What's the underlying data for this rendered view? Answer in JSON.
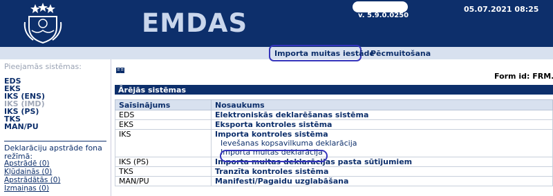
{
  "header": {
    "brand": "EMDAS",
    "version": "v. 5.9.0.0250",
    "datetime": "05.07.2021 08:25"
  },
  "nav": {
    "items": [
      {
        "label": "Importa muitas iestāde",
        "active": true
      },
      {
        "label": "Pēcmuitošana",
        "active": false
      }
    ]
  },
  "sidebar": {
    "title": "Pieejamās sistēmas:",
    "systems": [
      {
        "label": "EDS",
        "enabled": true
      },
      {
        "label": "EKS",
        "enabled": true
      },
      {
        "label": "IKS (ENS)",
        "enabled": true
      },
      {
        "label": "IKS (IMD)",
        "enabled": false
      },
      {
        "label": "IKS (PS)",
        "enabled": true
      },
      {
        "label": "TKS",
        "enabled": true
      },
      {
        "label": "MAN/PU",
        "enabled": true
      }
    ],
    "background_title": "Deklarāciju apstrāde fona režīmā:",
    "background_links": [
      "Apstrādē (0)",
      "Kļūdainās (0)",
      "Apstrādātās (0)",
      "Izmaiņas (0)"
    ]
  },
  "main": {
    "form_id": "Form id: FRM.KO",
    "panel_title": "Ārējās sistēmas",
    "columns": [
      "Saīsinājums",
      "Nosaukums"
    ],
    "rows": [
      {
        "code": "EDS",
        "name": "Elektroniskās deklarēšanas sistēma",
        "subs": []
      },
      {
        "code": "EKS",
        "name": "Eksporta kontroles sistēma",
        "subs": []
      },
      {
        "code": "IKS",
        "name": "Importa kontroles sistēma",
        "subs": [
          "Ievešanas kopsavilkuma deklarācija",
          "Importa muitas deklarācija"
        ]
      },
      {
        "code": "IKS (PS)",
        "name": "Importa muitas deklarācijas pasta sūtījumiem",
        "subs": []
      },
      {
        "code": "TKS",
        "name": "Tranzīta kontroles sistēma",
        "subs": []
      },
      {
        "code": "MAN/PU",
        "name": "Manifesti/Pagaidu uzglabāšana",
        "subs": []
      }
    ]
  },
  "colors": {
    "header_bg": "#0d2f6b",
    "nav_bg": "#d8e1ef",
    "highlight": "#3333bb"
  },
  "icons": {
    "crest": "coat-of-arms-icon",
    "book": "book-icon"
  }
}
